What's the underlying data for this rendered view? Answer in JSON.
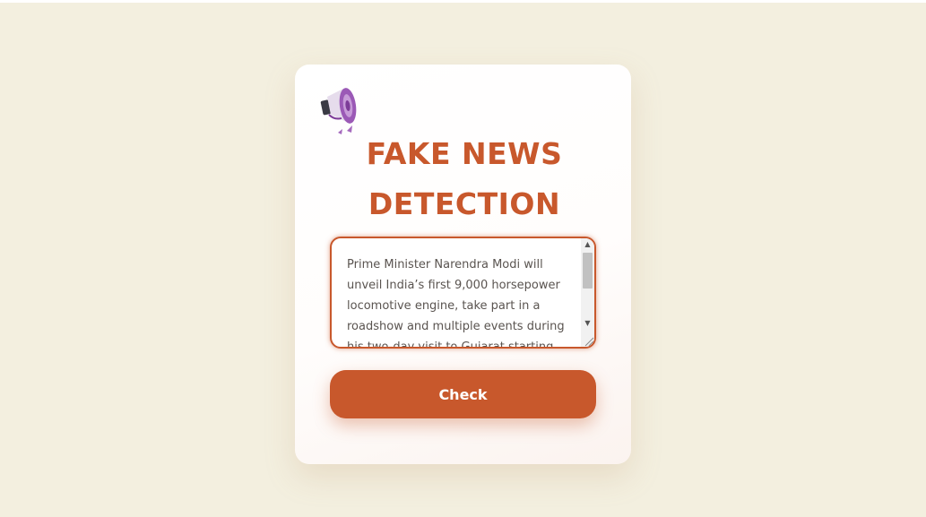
{
  "app": {
    "title_line1": "FAKE NEWS",
    "title_line2": "DETECTION"
  },
  "news_input": {
    "value": "Prime Minister Narendra Modi will unveil India’s first 9,000 horsepower locomotive engine, take part in a roadshow and multiple events during his two-day visit to Gujarat starting"
  },
  "check_button": {
    "label": "Check"
  },
  "icons": {
    "logo": "megaphone-icon",
    "scroll_up": "chevron-up-icon",
    "scroll_down": "chevron-down-icon",
    "resize": "resize-grip-icon"
  },
  "colors": {
    "background": "#f3efdf",
    "accent": "#c8582c",
    "card": "#ffffff",
    "megaphone": "#9b59b6"
  }
}
